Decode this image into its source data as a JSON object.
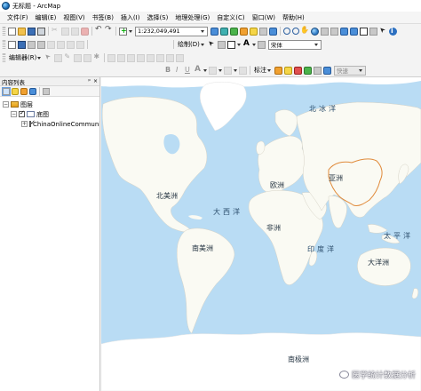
{
  "window": {
    "title": "无标题 - ArcMap",
    "app_icon": "arcmap-globe-icon"
  },
  "menubar": {
    "items": [
      "文件(F)",
      "编辑(E)",
      "视图(V)",
      "书签(B)",
      "插入(I)",
      "选择(S)",
      "地理处理(G)",
      "自定义(C)",
      "窗口(W)",
      "帮助(H)"
    ]
  },
  "toolbar": {
    "scale": "1:232,049,491",
    "editor_label": "编辑器(R)",
    "draw_label": "绘制(D)",
    "font": "宋体",
    "labeling_label": "标注",
    "fast_label": "快速"
  },
  "toc": {
    "title": "内容列表",
    "pin": "ᵖ",
    "close": "×",
    "layers_root": "图层",
    "group": "底图",
    "layer": "ChinaOnlineCommunity"
  },
  "map": {
    "labels": {
      "arctic": "北冰洋",
      "north_america": "北美洲",
      "europe": "欧洲",
      "asia": "亚洲",
      "atlantic": "大西洋",
      "africa": "非洲",
      "pacific": "太平洋",
      "south_america": "南美洲",
      "indian": "印度洋",
      "oceania": "大洋洲",
      "antarctica": "南极洲"
    },
    "colors": {
      "ocean": "#b9dcf4",
      "land": "#fafaf3",
      "ice": "#ffffff",
      "china_border": "#e08a3a"
    }
  },
  "watermark": "医学统计数据分析"
}
